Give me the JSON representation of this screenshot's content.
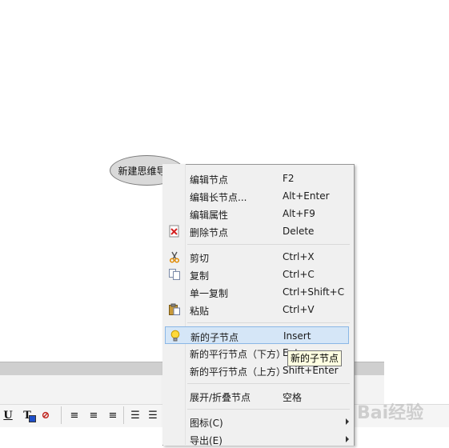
{
  "mindmap": {
    "root_node": "新建思维导图"
  },
  "context_menu": {
    "items": [
      {
        "label": "编辑节点",
        "shortcut": "F2"
      },
      {
        "label": "编辑长节点...",
        "shortcut": "Alt+Enter"
      },
      {
        "label": "编辑属性",
        "shortcut": "Alt+F9"
      },
      {
        "label": "删除节点",
        "shortcut": "Delete",
        "icon": "delete-icon"
      },
      {
        "label": "剪切",
        "shortcut": "Ctrl+X",
        "icon": "scissors-icon"
      },
      {
        "label": "复制",
        "shortcut": "Ctrl+C",
        "icon": "copy-icon"
      },
      {
        "label": "单一复制",
        "shortcut": "Ctrl+Shift+C"
      },
      {
        "label": "粘贴",
        "shortcut": "Ctrl+V",
        "icon": "paste-icon"
      },
      {
        "label": "新的子节点",
        "shortcut": "Insert",
        "icon": "lightbulb-icon",
        "highlighted": true
      },
      {
        "label": "新的平行节点（下方）",
        "shortcut": "Enter"
      },
      {
        "label": "新的平行节点（上方）",
        "shortcut": "Shift+Enter"
      },
      {
        "label": "展开/折叠节点",
        "shortcut": "空格"
      },
      {
        "label": "图标(C)",
        "submenu": true
      },
      {
        "label": "导出(E)",
        "submenu": true
      }
    ]
  },
  "tooltip": {
    "text": "新的子节点"
  },
  "toolbar": {
    "buttons": [
      {
        "name": "underline-button",
        "glyph": "U"
      },
      {
        "name": "font-color-button",
        "glyph": "T"
      },
      {
        "name": "no-format-button",
        "glyph": "⊘"
      },
      {
        "name": "align-left-button",
        "glyph": "≡"
      },
      {
        "name": "align-center-button",
        "glyph": "≡"
      },
      {
        "name": "align-right-button",
        "glyph": "≡"
      },
      {
        "name": "bullet-list-button",
        "glyph": "☰"
      },
      {
        "name": "numbered-list-button",
        "glyph": "☰"
      }
    ]
  },
  "watermark": {
    "text": "Bai经验"
  },
  "colors": {
    "highlight": "#d5e6f7",
    "highlight_border": "#8ab7e6",
    "menu_bg": "#f0f0f0",
    "node_fill": "#d9d9d9"
  }
}
